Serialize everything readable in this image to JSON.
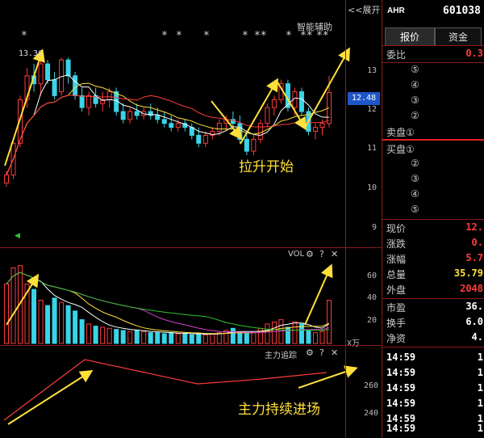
{
  "top_bar": {
    "expand_label": "<<展开",
    "assist_label": "智能辅助"
  },
  "price_chart": {
    "high_marker": "13.36",
    "current_price_tag": "12.48",
    "y_ticks": [
      "13",
      "12",
      "11",
      "10",
      "9"
    ],
    "annotation": "拉升开始",
    "stars": [
      "*",
      "*",
      "*",
      "*",
      "*",
      "**",
      "*",
      "**",
      "**"
    ]
  },
  "vol_panel": {
    "title": "VOL",
    "y_ticks": [
      "60",
      "40",
      "20"
    ],
    "unit": "X万"
  },
  "zhuli_panel": {
    "title": "主力追踪",
    "y_ticks": [
      "260",
      "240"
    ],
    "annotation": "主力持续进场"
  },
  "right_panel": {
    "market": "AHR",
    "code": "601038",
    "tabs": [
      "报价",
      "资金"
    ],
    "weibi_label": "委比",
    "weibi_value": "0.3",
    "sell_levels": [
      "⑤",
      "④",
      "③",
      "②"
    ],
    "sell1_label": "卖盘①",
    "buy1_label": "买盘①",
    "buy_levels": [
      "②",
      "③",
      "④",
      "⑤"
    ],
    "stats": [
      {
        "label": "现价",
        "value": "12."
      },
      {
        "label": "涨跌",
        "value": "0."
      },
      {
        "label": "涨幅",
        "value": "5.7"
      },
      {
        "label": "总量",
        "value": "35.79"
      },
      {
        "label": "外盘",
        "value": "2048"
      }
    ],
    "stats2": [
      {
        "label": "市盈",
        "value": "36."
      },
      {
        "label": "换手",
        "value": "6.0"
      },
      {
        "label": "净资",
        "value": "4."
      }
    ],
    "ticks": [
      {
        "time": "14:59",
        "value": "1"
      },
      {
        "time": "14:59",
        "value": "1"
      },
      {
        "time": "14:59",
        "value": "1"
      },
      {
        "time": "14:59",
        "value": "1"
      },
      {
        "time": "14:59",
        "value": "1"
      },
      {
        "time": "14:59",
        "value": "1"
      }
    ]
  },
  "colors": {
    "up": "#ff3b3b",
    "down": "#3ad4e8",
    "ma5": "#ffffff",
    "ma10": "#ffe03a",
    "ma20": "#d040d0",
    "ma30": "#30c030",
    "annotation": "#ffe03a",
    "frame": "#8b1a1a"
  },
  "chart_data": {
    "type": "candlestick",
    "candles": [
      [
        10.2,
        10.5,
        10.1,
        10.4
      ],
      [
        10.4,
        11.3,
        10.3,
        11.2
      ],
      [
        11.2,
        12.4,
        11.1,
        12.3
      ],
      [
        12.3,
        13.1,
        12.1,
        12.9
      ],
      [
        12.9,
        13.2,
        12.5,
        12.7
      ],
      [
        12.7,
        13.3,
        12.4,
        13.2
      ],
      [
        13.2,
        13.3,
        12.7,
        12.8
      ],
      [
        12.8,
        13.0,
        12.3,
        12.4
      ],
      [
        12.5,
        13.36,
        12.4,
        13.3
      ],
      [
        13.3,
        13.36,
        12.7,
        12.9
      ],
      [
        12.9,
        13.0,
        12.3,
        12.4
      ],
      [
        12.4,
        12.6,
        12.0,
        12.1
      ],
      [
        12.1,
        12.5,
        11.9,
        12.4
      ],
      [
        12.4,
        12.6,
        12.1,
        12.2
      ],
      [
        12.2,
        12.5,
        12.0,
        12.3
      ],
      [
        12.3,
        12.6,
        12.1,
        12.5
      ],
      [
        12.5,
        12.6,
        11.9,
        12.0
      ],
      [
        12.0,
        12.2,
        11.7,
        11.8
      ],
      [
        11.8,
        12.1,
        11.7,
        12.0
      ],
      [
        12.0,
        12.2,
        11.8,
        11.9
      ],
      [
        11.9,
        12.1,
        11.8,
        12.0
      ],
      [
        12.0,
        12.2,
        11.8,
        11.9
      ],
      [
        11.9,
        12.1,
        11.7,
        11.8
      ],
      [
        11.8,
        12.0,
        11.6,
        11.7
      ],
      [
        11.7,
        11.9,
        11.5,
        11.6
      ],
      [
        11.6,
        11.8,
        11.5,
        11.7
      ],
      [
        11.7,
        11.8,
        11.5,
        11.6
      ],
      [
        11.6,
        11.7,
        11.3,
        11.4
      ],
      [
        11.4,
        11.6,
        11.1,
        11.2
      ],
      [
        11.2,
        11.5,
        11.1,
        11.4
      ],
      [
        11.4,
        11.6,
        11.3,
        11.5
      ],
      [
        11.5,
        11.8,
        11.4,
        11.7
      ],
      [
        11.7,
        11.9,
        11.5,
        11.8
      ],
      [
        11.8,
        12.0,
        11.6,
        11.7
      ],
      [
        11.7,
        11.9,
        11.2,
        11.3
      ],
      [
        11.3,
        11.5,
        10.9,
        11.0
      ],
      [
        11.0,
        11.4,
        10.9,
        11.3
      ],
      [
        11.3,
        11.8,
        11.2,
        11.7
      ],
      [
        11.7,
        12.2,
        11.6,
        12.1
      ],
      [
        12.1,
        12.4,
        11.9,
        12.3
      ],
      [
        12.3,
        12.8,
        12.2,
        12.7
      ],
      [
        12.7,
        12.8,
        12.0,
        12.1
      ],
      [
        12.1,
        12.6,
        11.9,
        12.5
      ],
      [
        12.5,
        12.6,
        11.9,
        12.0
      ],
      [
        12.0,
        12.1,
        11.4,
        11.5
      ],
      [
        11.5,
        11.7,
        11.3,
        11.6
      ],
      [
        11.6,
        11.8,
        11.4,
        11.7
      ],
      [
        11.7,
        12.9,
        11.6,
        12.48
      ]
    ],
    "volumes": [
      55,
      70,
      72,
      55,
      50,
      40,
      35,
      42,
      38,
      35,
      30,
      22,
      18,
      16,
      15,
      14,
      13,
      12,
      11,
      12,
      11,
      10,
      10,
      9,
      10,
      9,
      9,
      8,
      9,
      8,
      9,
      10,
      12,
      14,
      10,
      9,
      10,
      14,
      18,
      20,
      22,
      15,
      20,
      18,
      12,
      10,
      11,
      40
    ],
    "price_range": [
      8.7,
      14.2
    ],
    "vol_range": [
      0,
      80
    ],
    "zhuli_range": [
      230,
      280
    ]
  }
}
